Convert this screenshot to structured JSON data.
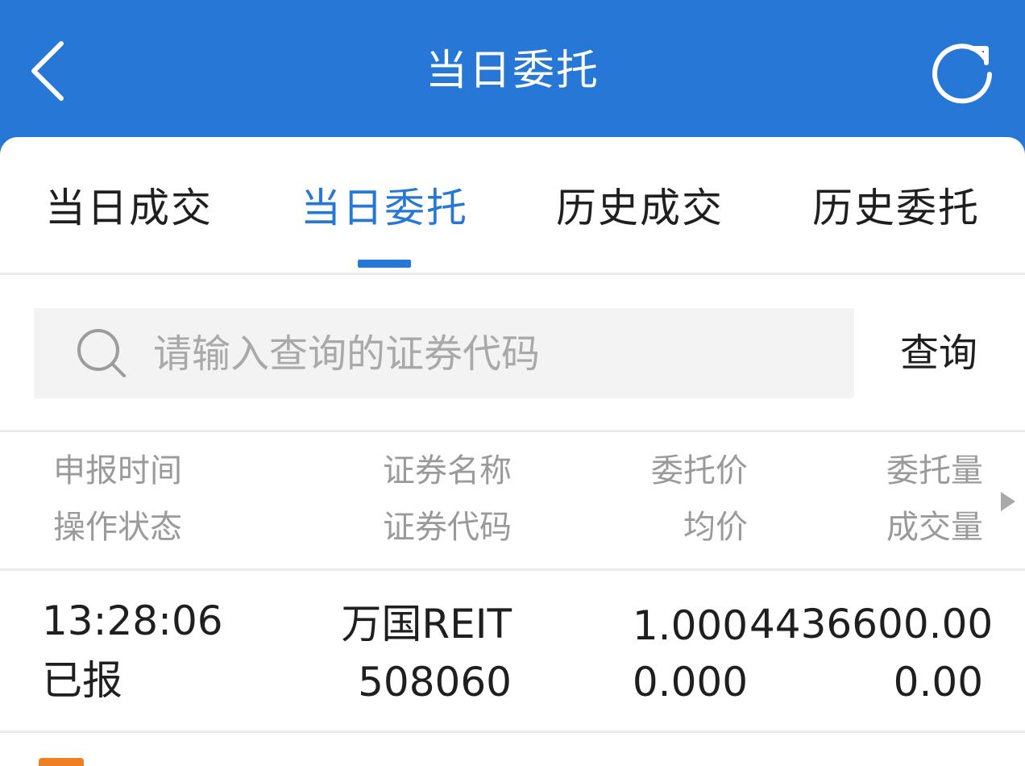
{
  "header": {
    "title": "当日委托",
    "back_icon": "chevron-left-icon",
    "refresh_icon": "refresh-icon"
  },
  "tabs": [
    {
      "label": "当日成交",
      "active": false
    },
    {
      "label": "当日委托",
      "active": true
    },
    {
      "label": "历史成交",
      "active": false
    },
    {
      "label": "历史委托",
      "active": false
    }
  ],
  "search": {
    "placeholder": "请输入查询的证券代码",
    "value": "",
    "button_label": "查询",
    "icon": "search-icon"
  },
  "table": {
    "headers": {
      "col1": [
        "申报时间",
        "操作状态"
      ],
      "col2": [
        "证券名称",
        "证券代码"
      ],
      "col3": [
        "委托价",
        "均价"
      ],
      "col4": [
        "委托量",
        "成交量"
      ]
    },
    "rows": [
      {
        "time": "13:28:06",
        "status": "已报",
        "name": "万国REIT",
        "code": "508060",
        "price": "1.000",
        "avg_price": "0.000",
        "order_qty": "4436600.00",
        "deal_qty": "0.00"
      }
    ]
  },
  "colors": {
    "primary": "#2677d6",
    "badge": "#f07f23"
  }
}
